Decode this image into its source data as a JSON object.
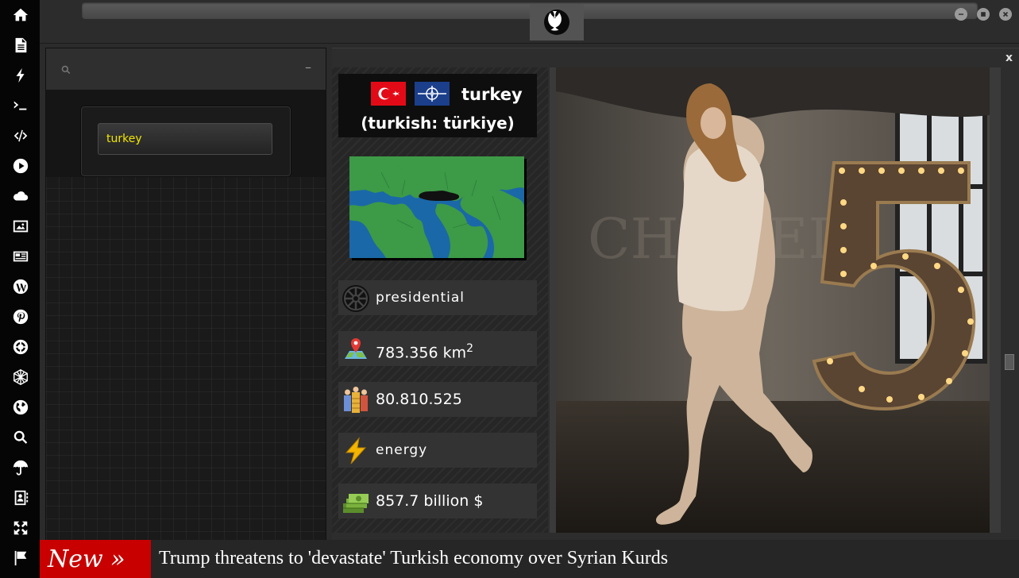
{
  "rail": {
    "items": [
      "home",
      "document",
      "lightning",
      "terminal",
      "code",
      "play",
      "cloud",
      "image",
      "newspaper",
      "wordpress",
      "pinterest",
      "settings",
      "polyhedron",
      "globe",
      "search",
      "umbrella",
      "contacts",
      "expand",
      "flag"
    ]
  },
  "search_panel": {
    "query": "turkey",
    "minimize_label": "–"
  },
  "country": {
    "name": "turkey",
    "native_name": "(turkish: türkiye)",
    "government": "presidential",
    "area_value": "783.356 km",
    "area_exp": "2",
    "population": "80.810.525",
    "sector": "energy",
    "gdp": "857.7 billion $"
  },
  "main_panel": {
    "close_label": "x"
  },
  "ticker": {
    "badge": "New »",
    "headline": "Trump threatens to 'devastate' Turkish economy over Syrian Kurds"
  },
  "colors": {
    "accent_yellow": "#f2e600",
    "ticker_red": "#c80000"
  }
}
